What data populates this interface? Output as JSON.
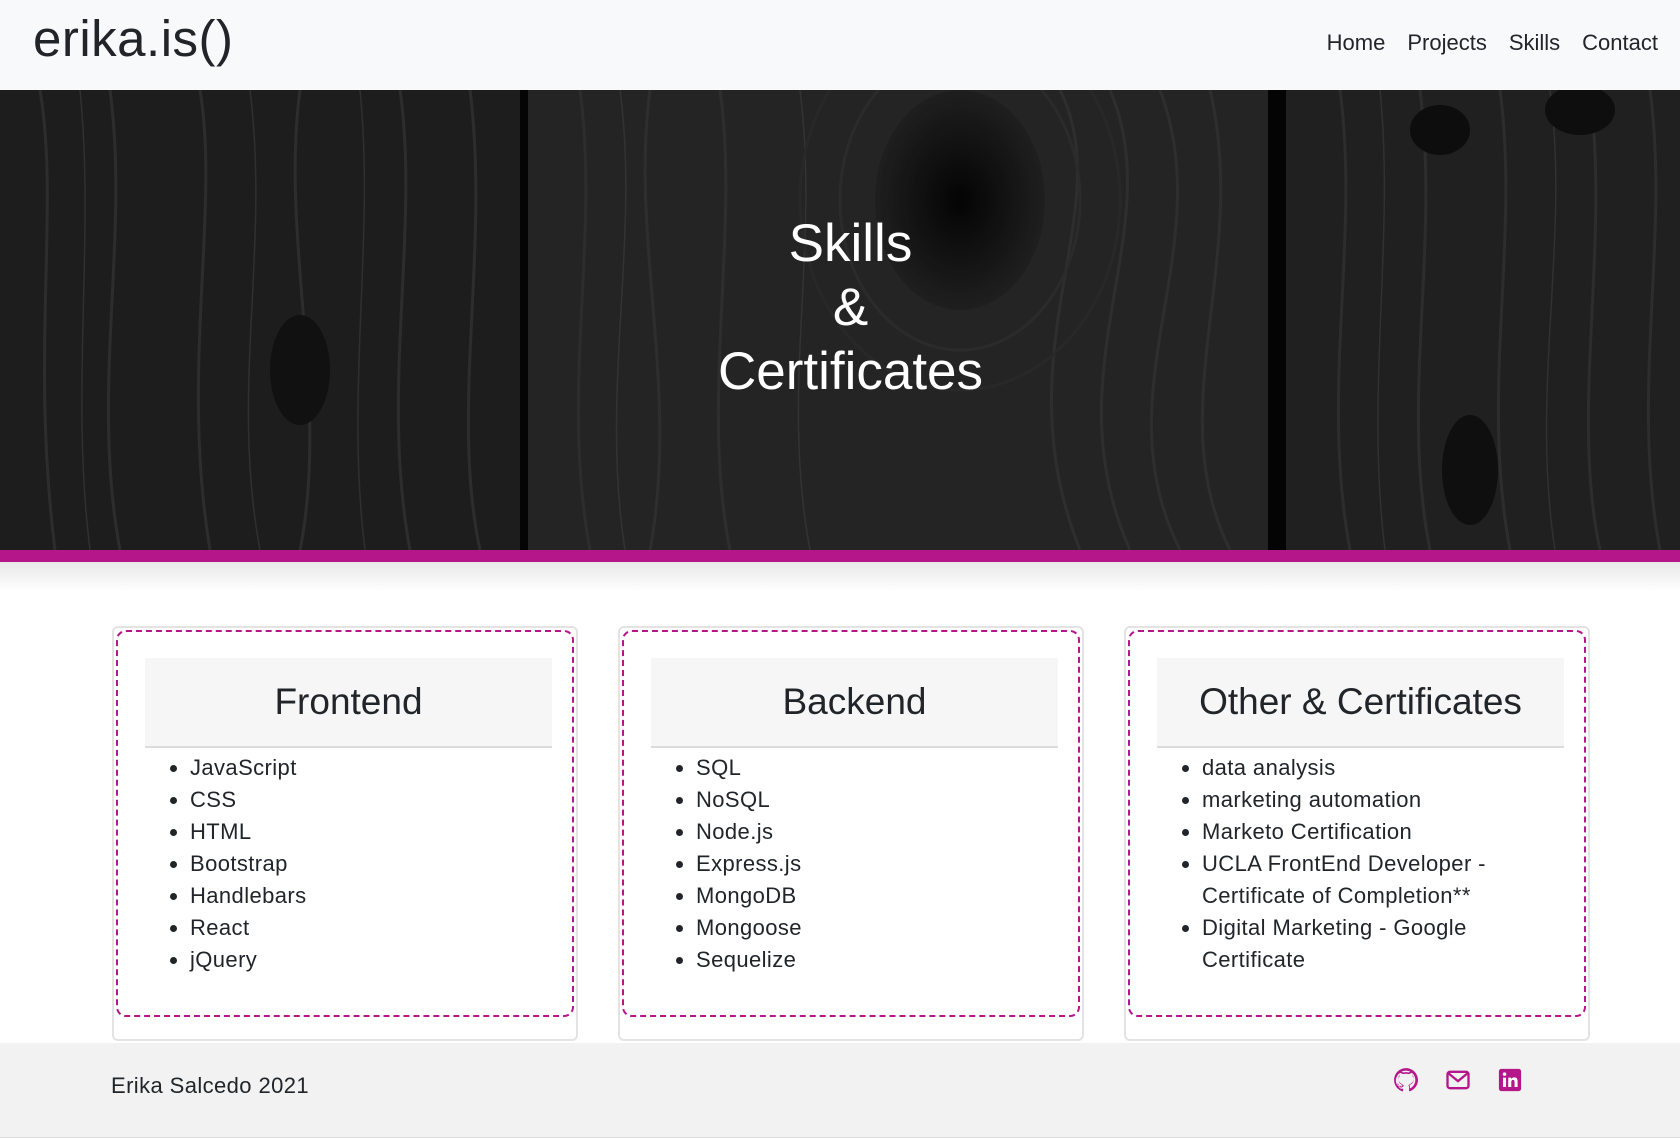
{
  "navbar": {
    "brand": "erika.is()",
    "links": [
      "Home",
      "Projects",
      "Skills",
      "Contact"
    ]
  },
  "hero": {
    "title_lines": [
      "Skills",
      "&",
      "Certificates"
    ]
  },
  "cards": [
    {
      "title": "Frontend",
      "items": [
        "JavaScript",
        "CSS",
        "HTML",
        "Bootstrap",
        "Handlebars",
        "React",
        "jQuery"
      ]
    },
    {
      "title": "Backend",
      "items": [
        "SQL",
        "NoSQL",
        "Node.js",
        "Express.js",
        "MongoDB",
        "Mongoose",
        "Sequelize"
      ]
    },
    {
      "title": "Other & Certificates",
      "items": [
        "data analysis",
        "marketing automation",
        "Marketo Certification",
        "UCLA FrontEnd Developer - Certificate of Completion**",
        "Digital Marketing - Google Certificate"
      ]
    }
  ],
  "footer": {
    "text": "Erika Salcedo 2021",
    "icons": [
      "github-icon",
      "mail-icon",
      "linkedin-icon"
    ]
  },
  "colors": {
    "accent": "#b5168a",
    "navbar_bg": "#f8f9fa",
    "footer_bg": "#f2f2f2",
    "hero_bg": "#1b1b1b"
  }
}
